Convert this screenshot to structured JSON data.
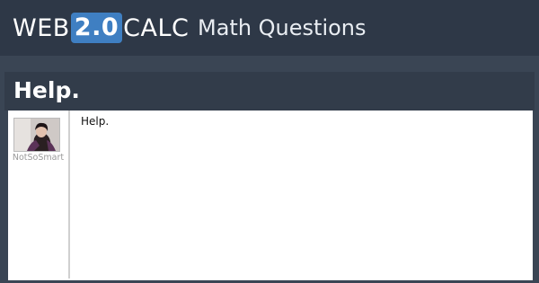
{
  "header": {
    "logo": {
      "part1": "WEB",
      "version": "2.0",
      "part2": "CALC"
    },
    "section_title": "Math Questions"
  },
  "question": {
    "title": "Help.",
    "body": "Help.",
    "author": {
      "username": "NotSoSmart"
    }
  },
  "colors": {
    "topbar": "#2e3847",
    "page_bg": "#3a4554",
    "logo_badge": "#3f7fc2"
  }
}
